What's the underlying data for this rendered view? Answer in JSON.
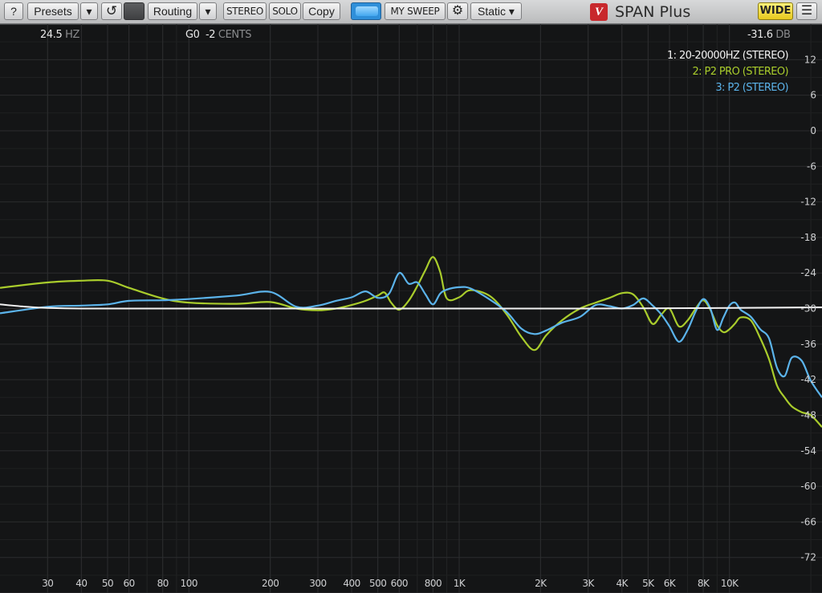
{
  "toolbar": {
    "help": "?",
    "presets": "Presets",
    "presets_arrow": "▾",
    "undo": "↺",
    "routing": "Routing",
    "routing_arrow": "▾",
    "stereo": "STEREO",
    "solo": "SOLO",
    "copy": "Copy",
    "sweep": "MY SWEEP",
    "settings": "⚙",
    "mode": "Static ▾",
    "product": "SPAN Plus",
    "logo": "V",
    "wide": "WIDE",
    "menu": "☰"
  },
  "readout": {
    "freq_value": "24.5",
    "freq_unit": "HZ",
    "note": "G0",
    "cents_value": "-2",
    "cents_unit": "CENTS",
    "db_value": "-31.6",
    "db_unit": "DB"
  },
  "legend": [
    {
      "label": "1: 20-20000HZ (STEREO)",
      "color": "#f2f2f2"
    },
    {
      "label": "2: P2 PRO (STEREO)",
      "color": "#a9cc2c"
    },
    {
      "label": "3: P2 (STEREO)",
      "color": "#5bb3ea"
    }
  ],
  "chart_data": {
    "type": "line",
    "xscale": "log",
    "xlim": [
      20,
      22000
    ],
    "ylim": [
      -78,
      18
    ],
    "y_ticks": [
      12,
      6,
      0,
      -6,
      -12,
      -18,
      -24,
      -30,
      -36,
      -42,
      -48,
      -54,
      -60,
      -66,
      -72
    ],
    "x_ticks": [
      {
        "v": 30,
        "label": "30"
      },
      {
        "v": 40,
        "label": "40"
      },
      {
        "v": 50,
        "label": "50"
      },
      {
        "v": 60,
        "label": "60"
      },
      {
        "v": 80,
        "label": "80"
      },
      {
        "v": 100,
        "label": "100"
      },
      {
        "v": 200,
        "label": "200"
      },
      {
        "v": 300,
        "label": "300"
      },
      {
        "v": 400,
        "label": "400"
      },
      {
        "v": 500,
        "label": "500"
      },
      {
        "v": 600,
        "label": "600"
      },
      {
        "v": 800,
        "label": "800"
      },
      {
        "v": 1000,
        "label": "1K"
      },
      {
        "v": 2000,
        "label": "2K"
      },
      {
        "v": 3000,
        "label": "3K"
      },
      {
        "v": 4000,
        "label": "4K"
      },
      {
        "v": 5000,
        "label": "5K"
      },
      {
        "v": 6000,
        "label": "6K"
      },
      {
        "v": 8000,
        "label": "8K"
      },
      {
        "v": 10000,
        "label": "10K"
      }
    ],
    "grid": true,
    "series": [
      {
        "name": "1: 20-20000HZ (STEREO)",
        "color": "#f2f2f2",
        "x": [
          20,
          25,
          30,
          40,
          60,
          100,
          300,
          1000,
          3000,
          10000,
          22000
        ],
        "y": [
          -29.3,
          -29.7,
          -29.9,
          -30.0,
          -30.0,
          -30.0,
          -30.0,
          -30.0,
          -30.0,
          -29.9,
          -29.8
        ]
      },
      {
        "name": "2: P2 PRO (STEREO)",
        "color": "#a9cc2c",
        "x": [
          20,
          30,
          40,
          50,
          60,
          80,
          100,
          150,
          200,
          250,
          300,
          350,
          400,
          450,
          500,
          530,
          560,
          600,
          650,
          700,
          750,
          800,
          850,
          900,
          1000,
          1100,
          1300,
          1500,
          1700,
          1900,
          2100,
          2400,
          2800,
          3200,
          3600,
          4000,
          4400,
          4800,
          5200,
          5600,
          6000,
          6500,
          7000,
          7500,
          8000,
          8500,
          9000,
          9500,
          10000,
          10500,
          11000,
          12000,
          13000,
          14000,
          15000,
          16000,
          17000,
          18500,
          20000,
          22000
        ],
        "y": [
          -26.5,
          -25.6,
          -25.3,
          -25.3,
          -26.5,
          -28.3,
          -29.0,
          -29.2,
          -28.9,
          -30.0,
          -30.3,
          -30.0,
          -29.4,
          -28.7,
          -27.8,
          -27.3,
          -29.0,
          -30.2,
          -28.7,
          -26.2,
          -23.5,
          -21.3,
          -23.8,
          -28.3,
          -28.1,
          -26.9,
          -27.9,
          -31.0,
          -34.8,
          -37.0,
          -34.5,
          -32.0,
          -30.0,
          -29.0,
          -28.2,
          -27.4,
          -27.6,
          -29.8,
          -32.6,
          -31.0,
          -30.0,
          -33.0,
          -32.0,
          -30.0,
          -28.6,
          -30.2,
          -32.8,
          -34.0,
          -33.5,
          -32.5,
          -31.5,
          -32.0,
          -35.0,
          -38.5,
          -43.0,
          -45.0,
          -46.5,
          -47.5,
          -48.0,
          -50.0
        ]
      },
      {
        "name": "3: P2 (STEREO)",
        "color": "#5bb3ea",
        "x": [
          20,
          30,
          40,
          50,
          60,
          80,
          100,
          150,
          200,
          250,
          300,
          350,
          400,
          450,
          500,
          550,
          600,
          650,
          700,
          750,
          800,
          850,
          900,
          1000,
          1100,
          1300,
          1500,
          1700,
          1900,
          2100,
          2400,
          2800,
          3200,
          3600,
          4000,
          4400,
          4800,
          5200,
          5600,
          6000,
          6500,
          7000,
          7500,
          8000,
          8500,
          9000,
          9500,
          10000,
          10500,
          11000,
          12000,
          13000,
          14000,
          15000,
          16000,
          17000,
          18500,
          20000,
          22000
        ],
        "y": [
          -30.8,
          -29.7,
          -29.5,
          -29.3,
          -28.7,
          -28.6,
          -28.4,
          -27.8,
          -27.2,
          -29.7,
          -29.5,
          -28.7,
          -28.1,
          -27.1,
          -28.2,
          -27.5,
          -24.0,
          -25.8,
          -25.6,
          -27.6,
          -29.3,
          -27.5,
          -26.8,
          -26.4,
          -26.6,
          -28.5,
          -30.6,
          -33.4,
          -34.3,
          -33.7,
          -32.4,
          -31.4,
          -29.4,
          -29.6,
          -30.0,
          -29.4,
          -28.3,
          -29.5,
          -31.0,
          -33.0,
          -35.6,
          -33.6,
          -30.5,
          -28.4,
          -30.0,
          -33.6,
          -31.5,
          -29.5,
          -29.0,
          -30.2,
          -31.4,
          -33.5,
          -35.0,
          -40.0,
          -41.4,
          -38.3,
          -38.8,
          -42.2,
          -45.0
        ]
      }
    ]
  }
}
